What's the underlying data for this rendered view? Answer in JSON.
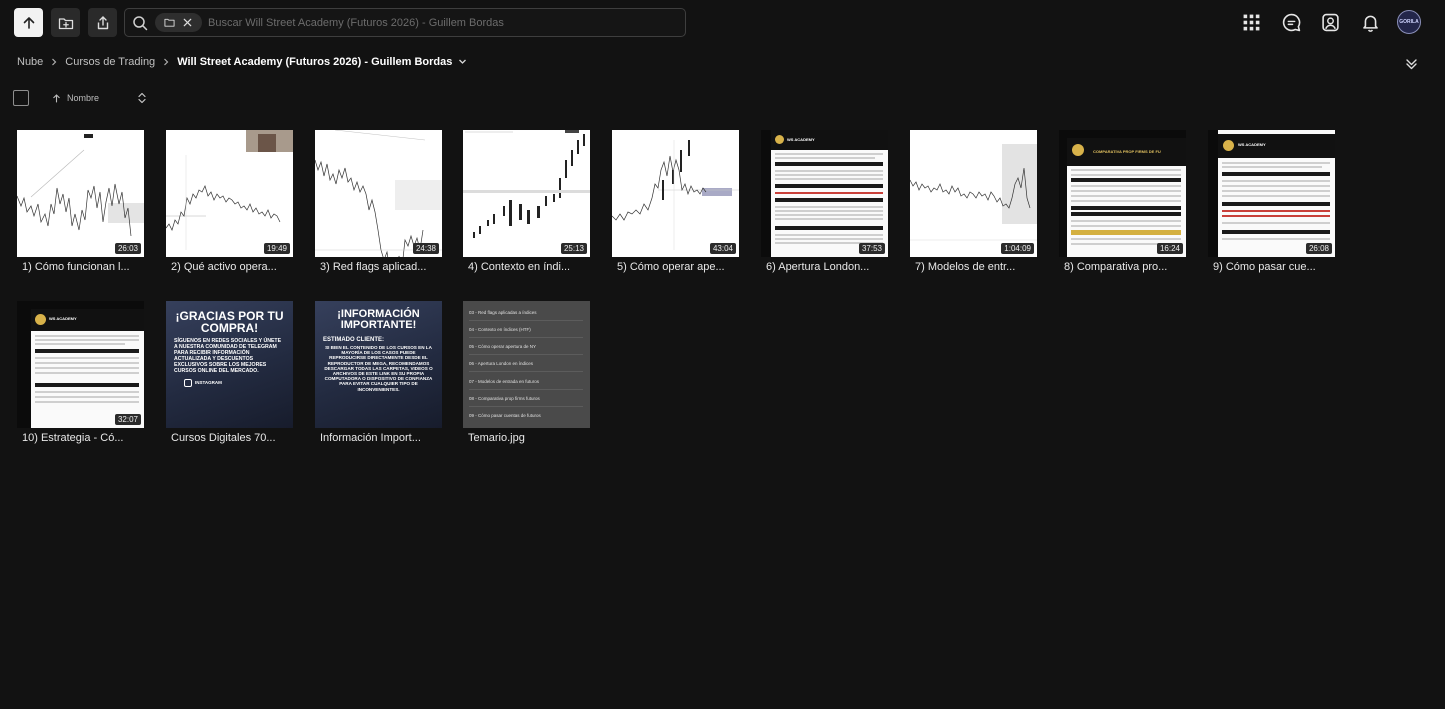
{
  "toolbar": {
    "search_placeholder": "Buscar Will Street Academy (Futuros 2026) - Guillem Bordas"
  },
  "header_icons": [
    "apps-grid-icon",
    "chat-icon",
    "contacts-icon",
    "bell-icon"
  ],
  "avatar_text": "GORILA",
  "breadcrumb": {
    "root": "Nube",
    "parent": "Cursos de Trading",
    "current": "Will Street Academy (Futuros 2026) - Guillem Bordas"
  },
  "sort": {
    "label": "Nombre",
    "direction": "ascending"
  },
  "colors": {
    "background": "#121212",
    "tile_label": "#e8e8e8",
    "duration_badge": "#2b2b2b"
  },
  "files": [
    {
      "name": "1) Cómo funcionan l...",
      "duration": "26:03",
      "type": "video"
    },
    {
      "name": "2) Qué activo opera...",
      "duration": "19:49",
      "type": "video"
    },
    {
      "name": "3) Red flags aplicad...",
      "duration": "24:38",
      "type": "video"
    },
    {
      "name": "4) Contexto en índi...",
      "duration": "25:13",
      "type": "video"
    },
    {
      "name": "5) Cómo operar ape...",
      "duration": "43:04",
      "type": "video"
    },
    {
      "name": "6) Apertura London...",
      "duration": "37:53",
      "type": "video"
    },
    {
      "name": "7) Modelos de entr...",
      "duration": "1:04:09",
      "type": "video"
    },
    {
      "name": "8) Comparativa pro...",
      "duration": "16:24",
      "type": "video"
    },
    {
      "name": "9) Cómo pasar cue...",
      "duration": "26:08",
      "type": "video"
    },
    {
      "name": "10) Estrategia - Có...",
      "duration": "32:07",
      "type": "video"
    },
    {
      "name": "Cursos Digitales 70...",
      "type": "image"
    },
    {
      "name": "Información Import...",
      "type": "image"
    },
    {
      "name": "Temario.jpg",
      "type": "image"
    }
  ],
  "thumbnail_text": {
    "ws_academy": "WS ACADEMY",
    "comparativa_header": "COMPARATIVA PROP FIRMS DE FU",
    "gracias_title": "¡GRACIAS POR TU COMPRA!",
    "gracias_body": "SÍGUENOS EN REDES SOCIALES Y ÚNETE A NUESTRA COMUNIDAD DE TELEGRAM PARA RECIBIR INFORMACIÓN ACTUALIZADA Y DESCUENTOS EXCLUSIVOS SOBRE LOS MEJORES CURSOS ONLINE DEL MERCADO.",
    "gracias_social": "INSTAGRAM",
    "info_title": "¡INFORMACIÓN IMPORTANTE!",
    "info_sub": "ESTIMADO CLIENTE:",
    "info_body": "SI BIEN EL CONTENIDO DE LOS CURSOS EN LA MAYORÍA DE LOS CASOS PUEDE REPRODUCIRSE DIRECTAMENTE DESDE EL REPRODUCTOR DE MEGA, RECOMENDAMOS DESCARGAR TODAS LAS CARPETAS, VIDEOS O ARCHIVOS DE ESTE LINK EN SU PROPIA COMPUTADORA O DISPOSITIVO DE CONFIANZA PARA EVITAR CUALQUIER TIPO DE INCONVENIENTES.",
    "temario_lines": [
      "03 - Red flags aplicadas a índices",
      "04 - Contexto en índices (HTF)",
      "05 - Cómo operar apertura de NY",
      "06 - Apertura London en índices",
      "07 - Modelos de entrada en futuros",
      "08 - Comparativa prop firms futuros",
      "09 - Cómo pasar cuentas de futuros"
    ]
  }
}
